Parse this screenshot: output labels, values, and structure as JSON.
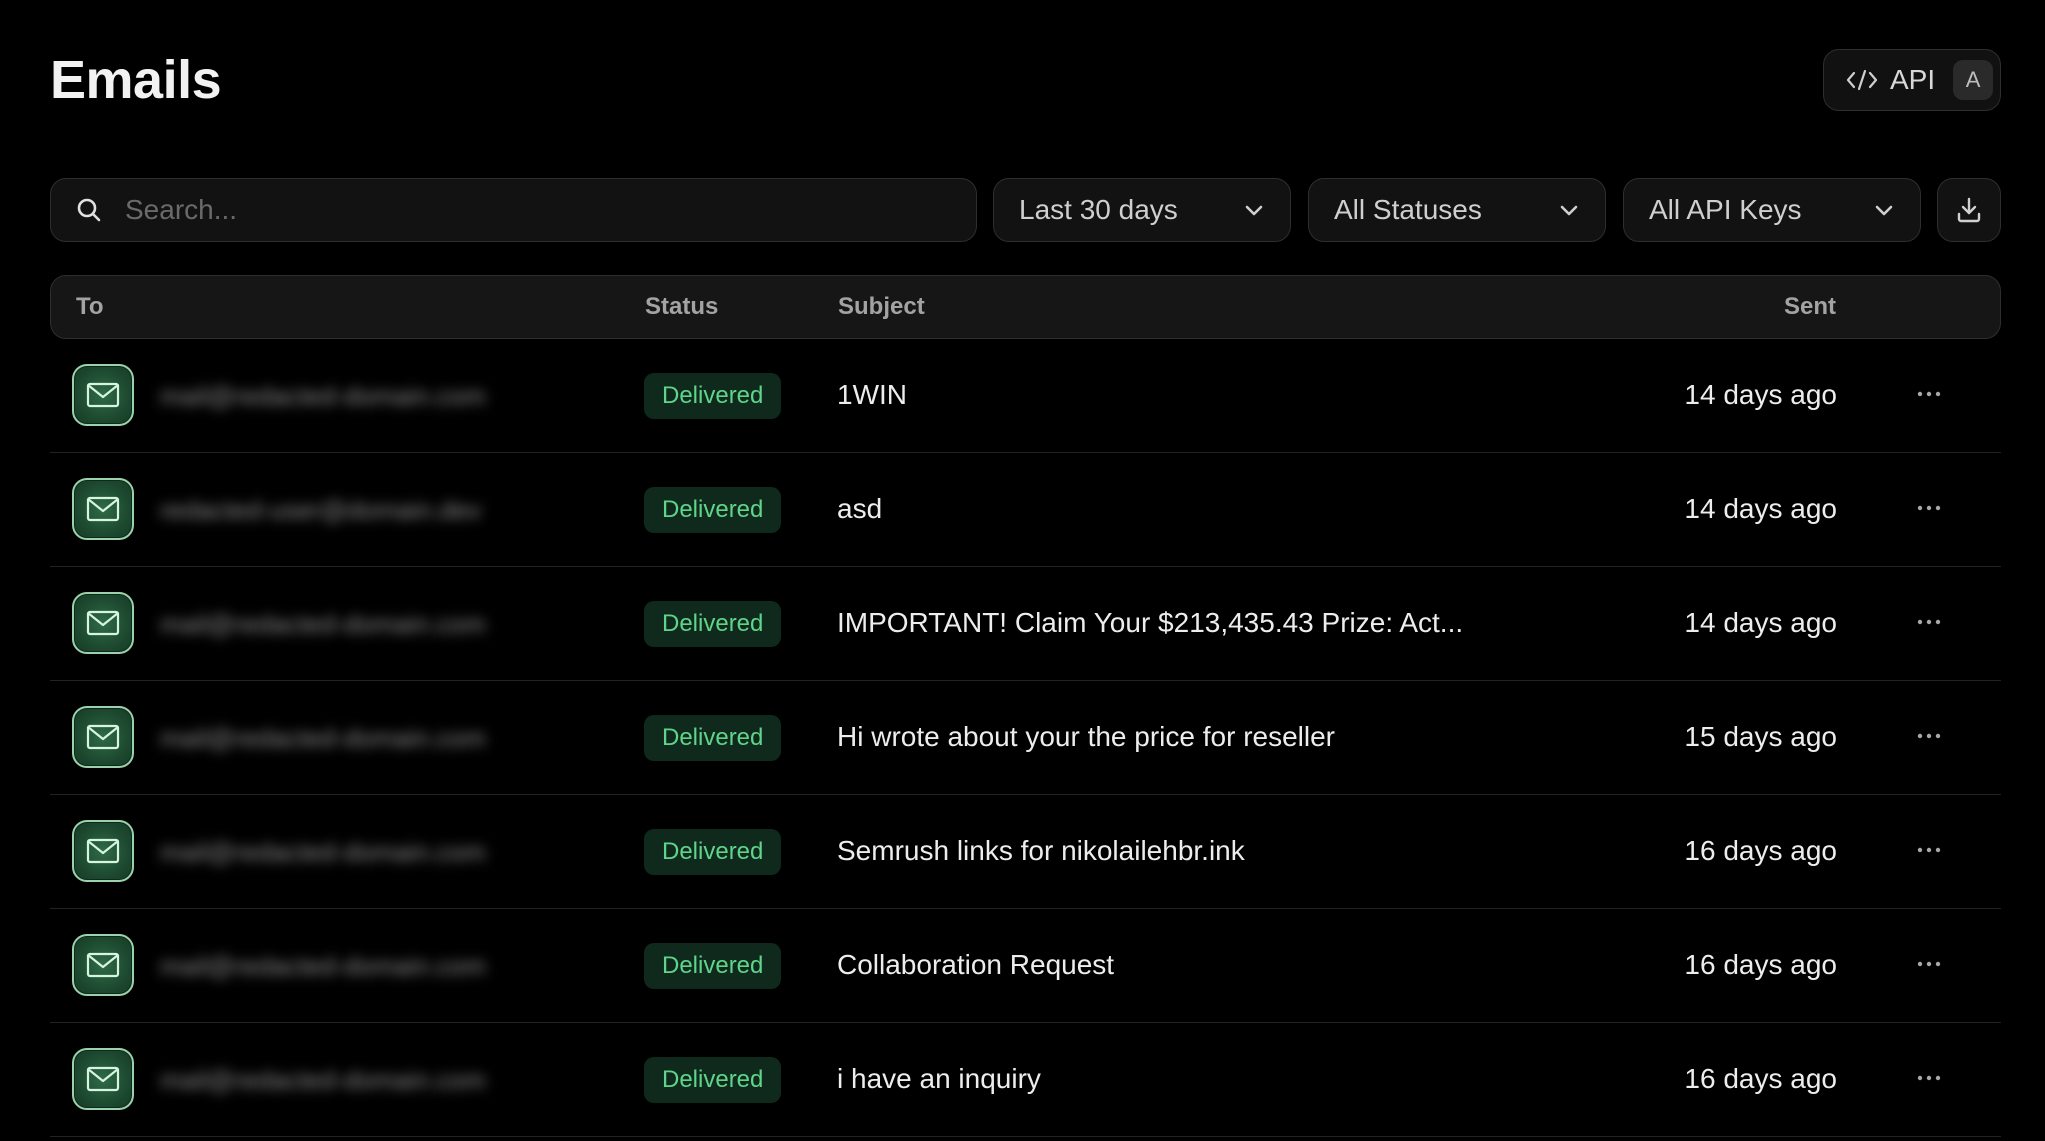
{
  "header": {
    "title": "Emails",
    "api_button": {
      "label": "API",
      "shortcut": "A",
      "icon": "code-icon"
    }
  },
  "filters": {
    "search": {
      "placeholder": "Search...",
      "value": "",
      "icon": "search-icon"
    },
    "date_range": {
      "selected": "Last 30 days"
    },
    "status": {
      "selected": "All Statuses"
    },
    "api_keys": {
      "selected": "All API Keys"
    },
    "download_icon": "download-icon"
  },
  "table": {
    "columns": {
      "to": "To",
      "status": "Status",
      "subject": "Subject",
      "sent": "Sent"
    },
    "rows": [
      {
        "to": "mail@redacted-domain.com",
        "status": "Delivered",
        "subject": "1WIN",
        "sent": "14 days ago"
      },
      {
        "to": "redacted-user@domain.dev",
        "status": "Delivered",
        "subject": "asd",
        "sent": "14 days ago"
      },
      {
        "to": "mail@redacted-domain.com",
        "status": "Delivered",
        "subject": "IMPORTANT! Claim Your $213,435.43 Prize: Act...",
        "sent": "14 days ago"
      },
      {
        "to": "mail@redacted-domain.com",
        "status": "Delivered",
        "subject": "Hi wrote about your the price for reseller",
        "sent": "15 days ago"
      },
      {
        "to": "mail@redacted-domain.com",
        "status": "Delivered",
        "subject": "Semrush links for nikolailehbr.ink",
        "sent": "16 days ago"
      },
      {
        "to": "mail@redacted-domain.com",
        "status": "Delivered",
        "subject": "Collaboration Request",
        "sent": "16 days ago"
      },
      {
        "to": "mail@redacted-domain.com",
        "status": "Delivered",
        "subject": "i have an inquiry",
        "sent": "16 days ago"
      }
    ]
  },
  "colors": {
    "background": "#000000",
    "delivered_text": "#5fd48a",
    "delivered_bg": "#0f2a1c",
    "avatar_green": "#2f6b47"
  }
}
